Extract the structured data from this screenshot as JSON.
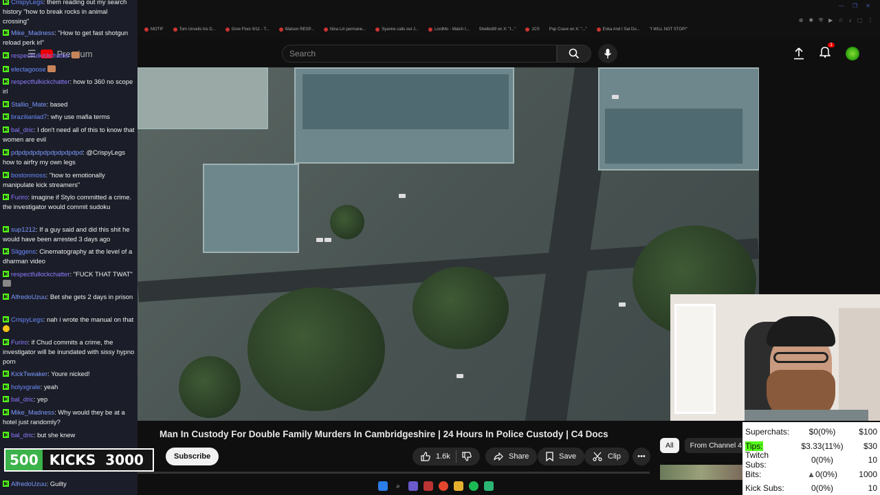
{
  "browser": {
    "bookmarks": [
      "MOTIF",
      "Tom Unveils his D...",
      "Gore Floor 9/11 - T...",
      "Watson RESP...",
      "Nina Lin permane...",
      "Syanne calls out J...",
      "LordMo - Watch t...",
      "Shelbo99 on X: \"I...\"",
      "JCS",
      "Pop Crave on X: \"...\"",
      "Enka And I Sat Do...",
      "\"I WILL NOT STOP!\""
    ]
  },
  "youtube": {
    "search_placeholder": "Search",
    "premium_label": "Premium",
    "notification_count": "1",
    "video_title": "Man In Custody For Double Family Murders In Cambridgeshire | 24 Hours In Police Custody | C4 Docs",
    "subscribe_label": "Subscribe",
    "like_count": "1.6k",
    "share_label": "Share",
    "save_label": "Save",
    "clip_label": "Clip",
    "chips": [
      "All",
      "From Channel 4"
    ]
  },
  "chat": {
    "messages": [
      {
        "user": "CrispyLegs",
        "color": "#6b8cff",
        "text": "them reading out my search history \"how to break rocks in animal crossing\""
      },
      {
        "user": "Mike_Madness",
        "color": "#7d9bff",
        "text": "\"How to get fast shotgun reload perk irl\""
      },
      {
        "user": "respectfulkickchatter",
        "color": "#8a7dff",
        "text": ""
      },
      {
        "user": "electagoose",
        "color": "#6b8cff",
        "text": ""
      },
      {
        "user": "respectfulkickchatter",
        "color": "#8a7dff",
        "text": "how to 360 no scope irl"
      },
      {
        "user": "Stallio_Mate",
        "color": "#7d9bff",
        "text": "based"
      },
      {
        "user": "brazilianlad7",
        "color": "#6b8cff",
        "text": "why use mafia terms"
      },
      {
        "user": "bal_dric",
        "color": "#8a7dff",
        "text": "I don't need all of this to know that women are evil"
      },
      {
        "user": "pdpdpdpdpdpdpdpdpdpd",
        "color": "#7d9bff",
        "text": "@CrispyLegs how to airfry my own legs"
      },
      {
        "user": "bostonmoss",
        "color": "#6b8cff",
        "text": "\"how to emotionally manipulate kick streamers\""
      },
      {
        "user": "Furiro",
        "color": "#8a7dff",
        "text": "imagine if Stylo committed a crime. the investigator would commit sudoku"
      },
      {
        "user": "sup1212",
        "color": "#7d9bff",
        "text": "If a guy said and did this shit he would have been arrested 3 days ago"
      },
      {
        "user": "Sliggens",
        "color": "#6b8cff",
        "text": "Cinematography at the level of a dharman video"
      },
      {
        "user": "respectfulkickchatter",
        "color": "#8a7dff",
        "text": "\"FUCK THAT TWAT\""
      },
      {
        "user": "AlfredoUzuu",
        "color": "#7d9bff",
        "text": "Bet she gets 2 days in prison"
      },
      {
        "user": "CrispyLegs",
        "color": "#6b8cff",
        "text": "nah i wrote the manual on that"
      },
      {
        "user": "Furiro",
        "color": "#8a7dff",
        "text": "if Chud commits a crime, the investigator will be inundated with sissy hypno porn"
      },
      {
        "user": "KickTweaker",
        "color": "#7d9bff",
        "text": "Youre nicked!"
      },
      {
        "user": "holyxgrale",
        "color": "#6b8cff",
        "text": "yeah"
      },
      {
        "user": "bal_dric",
        "color": "#8a7dff",
        "text": "yep"
      },
      {
        "user": "Mike_Madness",
        "color": "#7d9bff",
        "text": "Why would they be at a hotel just randomly?"
      },
      {
        "user": "bal_dric",
        "color": "#8a7dff",
        "text": "but she knew"
      },
      {
        "user": "AlfredoUzuu",
        "color": "#7d9bff",
        "text": "Guilty"
      }
    ]
  },
  "kicks": {
    "current": "500",
    "label": "KICKS",
    "goal": "3000"
  },
  "stats": {
    "rows": [
      {
        "label": "Superchats:",
        "value": "$0(0%)",
        "goal": "$100"
      },
      {
        "label": "Tips:",
        "value": "$3.33(11%)",
        "goal": "$30"
      },
      {
        "label": "Twitch Subs:",
        "value": "0(0%)",
        "goal": "10"
      },
      {
        "label": "Bits:",
        "value": "0(0%)",
        "goal": "1000"
      },
      {
        "label": "Kick Subs:",
        "value": "0(0%)",
        "goal": "10"
      }
    ]
  }
}
